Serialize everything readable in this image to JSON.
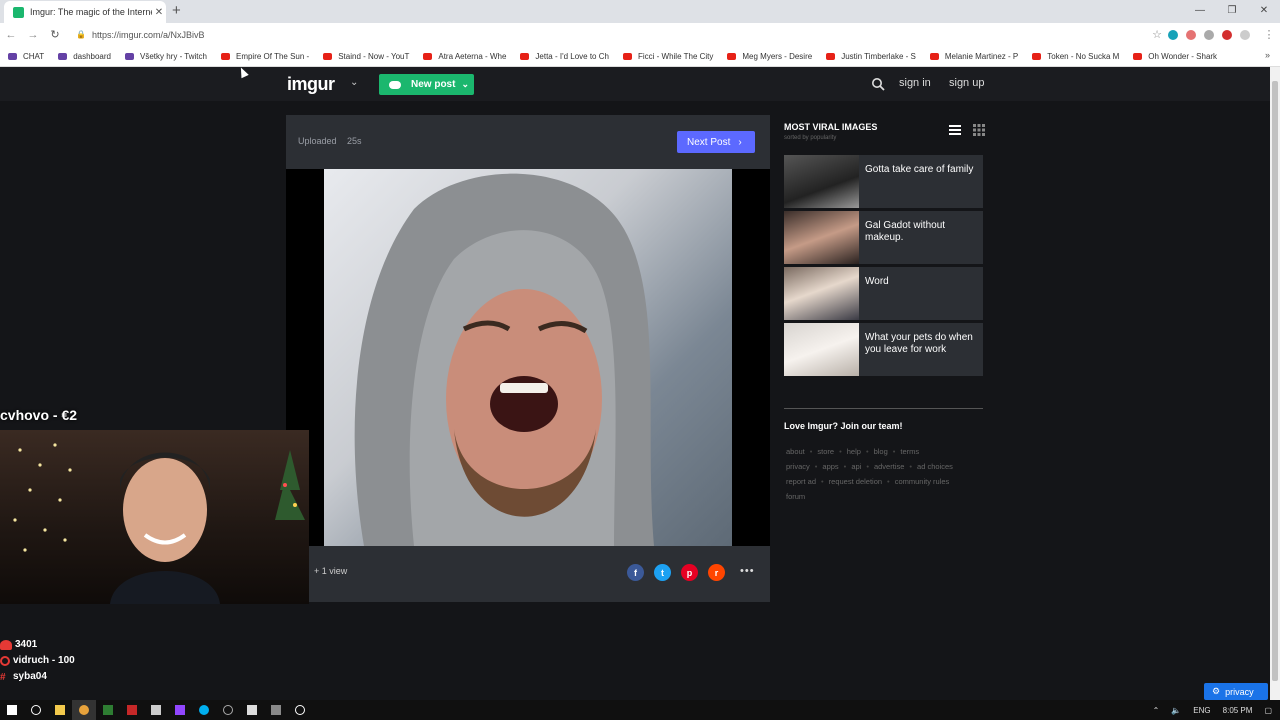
{
  "browser": {
    "tab_title": "Imgur: The magic of the Internet",
    "url": "https://imgur.com/a/NxJBivB",
    "bookmarks": [
      {
        "label": "CHAT",
        "icon": "chat-icon"
      },
      {
        "label": "dashboard",
        "icon": "twitch-icon"
      },
      {
        "label": "Všetky hry - Twitch",
        "icon": "twitch-icon"
      },
      {
        "label": "Empire Of The Sun -",
        "icon": "youtube-icon"
      },
      {
        "label": "Staind - Now - YouT",
        "icon": "youtube-icon"
      },
      {
        "label": "Atra Aeterna - Whe",
        "icon": "youtube-icon"
      },
      {
        "label": "Jetta - I'd Love to Ch",
        "icon": "youtube-icon"
      },
      {
        "label": "Ficci - While The City",
        "icon": "youtube-icon"
      },
      {
        "label": "Meg Myers - Desire",
        "icon": "youtube-icon"
      },
      {
        "label": "Justin Timberlake - S",
        "icon": "youtube-icon"
      },
      {
        "label": "Melanie Martinez - P",
        "icon": "youtube-icon"
      },
      {
        "label": "Token - No Sucka M",
        "icon": "youtube-icon"
      },
      {
        "label": "Oh Wonder - Shark",
        "icon": "youtube-icon"
      }
    ]
  },
  "imgur": {
    "logo": "imgur",
    "new_post": "New post",
    "sign_in": "sign in",
    "sign_up": "sign up",
    "accent": "#1bb76e"
  },
  "post": {
    "uploaded_label": "Uploaded",
    "age": "25s",
    "next_post": "Next Post",
    "views": "1 view"
  },
  "sidebar": {
    "title": "MOST VIRAL IMAGES",
    "subtitle": "sorted by popularity",
    "items": [
      {
        "title": "Gotta take care of family"
      },
      {
        "title": "Gal Gadot without makeup."
      },
      {
        "title": "Word"
      },
      {
        "title": "What your pets do when you leave for work"
      }
    ],
    "join": "Love Imgur? Join our team!",
    "footer_links": [
      "about",
      "store",
      "help",
      "blog",
      "terms",
      "privacy",
      "apps",
      "api",
      "advertise",
      "ad choices",
      "report ad",
      "request deletion",
      "community rules",
      "forum"
    ]
  },
  "overlay": {
    "donor": "cvhovo - €2",
    "stat1": "3401",
    "stat2": "vidruch - 100",
    "stat3": "syba04"
  },
  "taskbar": {
    "lang": "ENG",
    "time": "8:05 PM"
  },
  "privacy_button": "privacy"
}
